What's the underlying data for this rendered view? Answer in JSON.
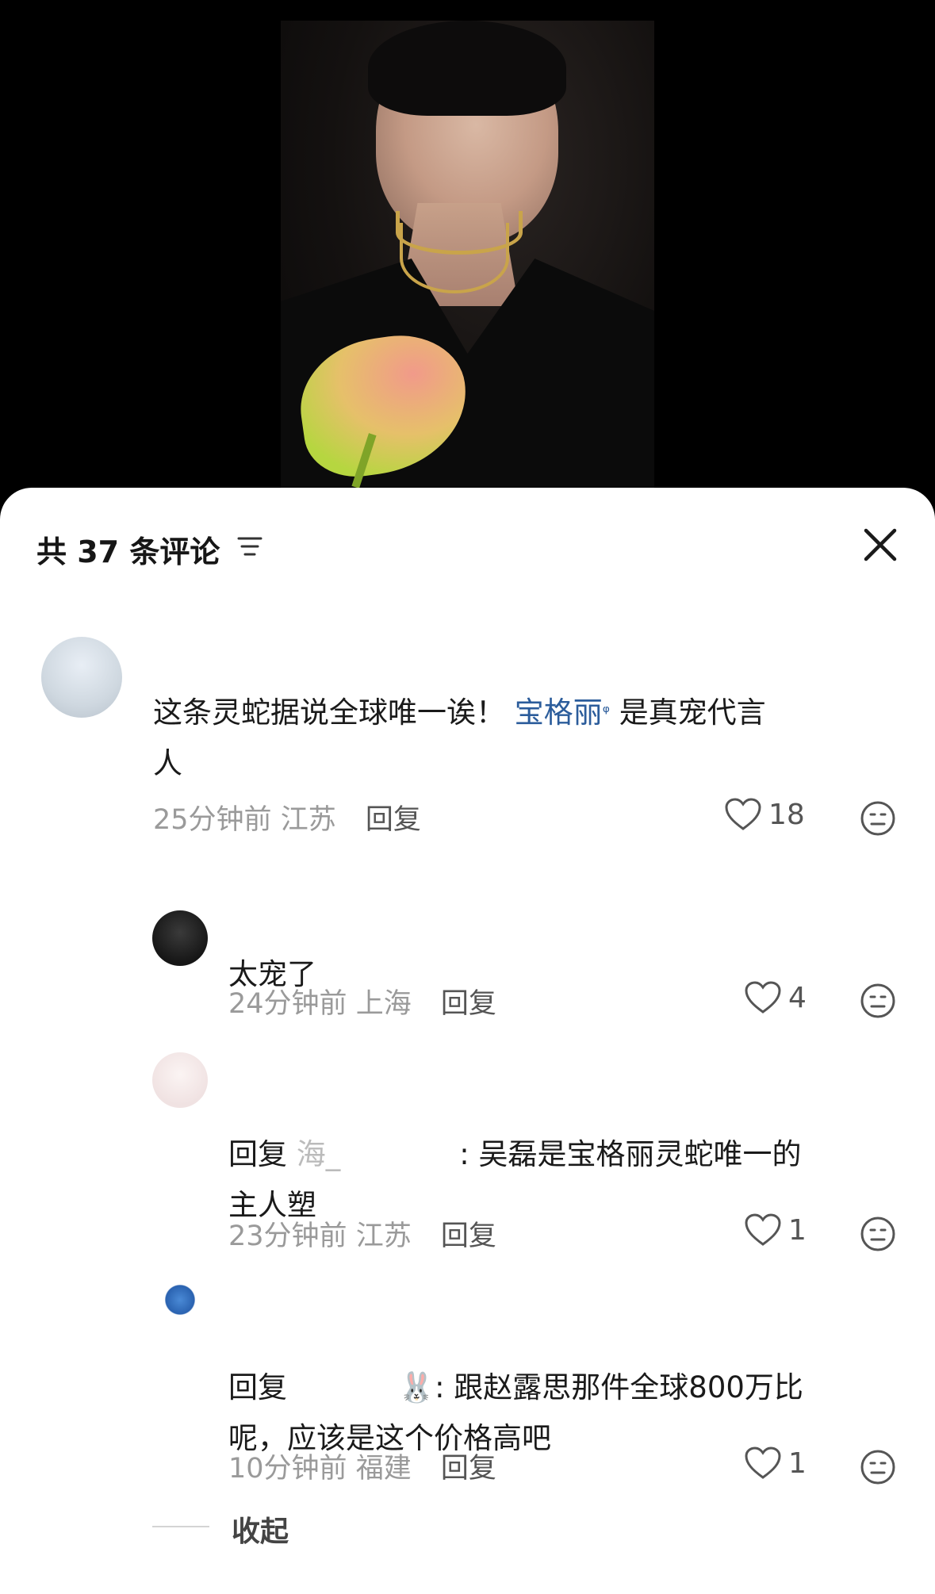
{
  "header": {
    "comment_count_label": "共 37 条评论"
  },
  "comments": [
    {
      "text_before_link": "这条灵蛇据说全球唯一诶！",
      "link": "宝格丽",
      "text_after_link": "是真宠代言",
      "text_line2": "人",
      "time": "25分钟前",
      "location": "江苏",
      "reply_label": "回复",
      "likes": "18"
    },
    {
      "text": "太宠了",
      "time": "24分钟前",
      "location": "上海",
      "reply_label": "回复",
      "likes": "4"
    },
    {
      "reply_prefix": "回复",
      "reply_to": "海_",
      "text_line1": ": 吴磊是宝格丽灵蛇唯一的",
      "text_line2": "主人塑",
      "time": "23分钟前",
      "location": "江苏",
      "reply_label": "回复",
      "likes": "1"
    },
    {
      "reply_prefix": "回复",
      "reply_to_emoji": "🐰",
      "text_line1": ": 跟赵露思那件全球800万比",
      "text_line2": "呢，应该是这个价格高吧",
      "time": "10分钟前",
      "location": "福建",
      "reply_label": "回复",
      "likes": "1"
    }
  ],
  "footer": {
    "collapse_label": "收起"
  },
  "icons": {
    "like": "heart-outline-icon",
    "dislike": "meh-face-icon",
    "close": "close-icon",
    "sort": "sort-lines-icon"
  },
  "colors": {
    "link": "#2b5c9b",
    "meta": "#9a9a9a",
    "text": "#1a1a1a"
  }
}
